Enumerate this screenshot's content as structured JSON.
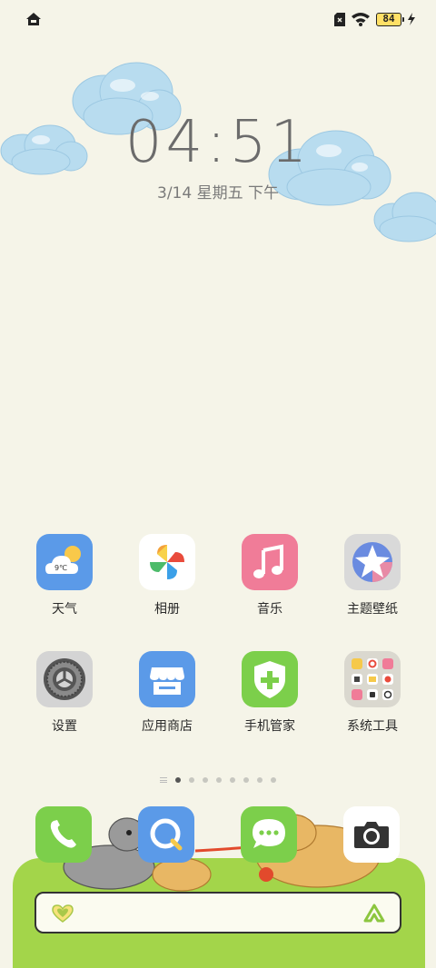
{
  "status_bar": {
    "left_icon": "home-nfc-icon",
    "battery_level": "84",
    "icons": [
      "sim-icon",
      "wifi-icon",
      "battery-icon",
      "charging-icon"
    ]
  },
  "lock": {
    "time": "04:51",
    "date": "3/14 星期五 下午"
  },
  "weather_icon_temp": "9℃",
  "apps": [
    {
      "label": "天气",
      "icon": "weather-icon"
    },
    {
      "label": "相册",
      "icon": "photos-icon"
    },
    {
      "label": "音乐",
      "icon": "music-icon"
    },
    {
      "label": "主题壁纸",
      "icon": "themes-icon"
    },
    {
      "label": "设置",
      "icon": "settings-icon"
    },
    {
      "label": "应用商店",
      "icon": "app-store-icon"
    },
    {
      "label": "手机管家",
      "icon": "phone-manager-icon"
    },
    {
      "label": "系统工具",
      "icon": "system-tools-folder-icon"
    }
  ],
  "pager": {
    "pages": 8,
    "current": 1
  },
  "dock": [
    {
      "icon": "phone-icon"
    },
    {
      "icon": "browser-icon"
    },
    {
      "icon": "messages-icon"
    },
    {
      "icon": "camera-icon"
    }
  ],
  "search": {
    "left_icon": "heart-icon",
    "right_icon": "assistant-icon"
  },
  "colors": {
    "background": "#f5f4e8",
    "dock_green": "#a3d54a",
    "weather_blue": "#5b9ae8",
    "music_pink": "#f07c98",
    "manager_green": "#7ccf4b"
  }
}
